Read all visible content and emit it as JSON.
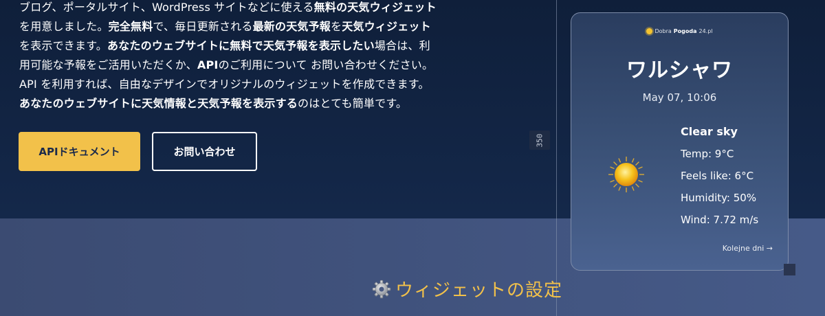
{
  "intro": {
    "lines": [
      [
        {
          "t": "ブログ、ポータルサイト、WordPress サイトなどに使える"
        },
        {
          "t": "無料の天気ウィジェット",
          "b": true
        }
      ],
      [
        {
          "t": "を用意しました。"
        },
        {
          "t": "完全無料",
          "b": true
        },
        {
          "t": "で、毎日更新される"
        },
        {
          "t": "最新の天気予報",
          "b": true
        },
        {
          "t": "を"
        },
        {
          "t": "天気ウィジェット",
          "b": true
        }
      ],
      [
        {
          "t": "を表示できます。"
        },
        {
          "t": "あなたのウェブサイトに無料で天気予報を表示したい",
          "b": true
        },
        {
          "t": "場合は、利"
        }
      ],
      [
        {
          "t": "用可能な予報をご活用いただくか、"
        },
        {
          "t": "API",
          "b": true
        },
        {
          "t": "のご利用について お問い合わせください。"
        }
      ],
      [
        {
          "t": "API を利用すれば、自由なデザインでオリジナルのウィジェットを作成できます。"
        }
      ],
      [
        {
          "t": "あなたのウェブサイトに天気情報と天気予報を表示する",
          "b": true
        },
        {
          "t": "のはとても簡単です。"
        }
      ]
    ]
  },
  "buttons": {
    "api_docs": "APIドキュメント",
    "contact": "お問い合わせ"
  },
  "size_marker": "350",
  "widget": {
    "logo_light": "Dobra",
    "logo_bold": "Pogoda",
    "logo_suffix": "24.pl",
    "city": "ワルシャワ",
    "datetime": "May 07, 10:06",
    "condition": "Clear sky",
    "temp": "Temp: 9°C",
    "feels_like": "Feels like: 6°C",
    "humidity": "Humidity: 50%",
    "wind": "Wind: 7.72 m/s",
    "next_link": "Kolejne dni →",
    "icon": "sun-icon"
  },
  "settings": {
    "title": "ウィジェットの設定",
    "icon": "gear-icon"
  },
  "colors": {
    "accent": "#f2c14a",
    "hero_bg": "#12243f",
    "lower_bg": "#3f5078"
  }
}
